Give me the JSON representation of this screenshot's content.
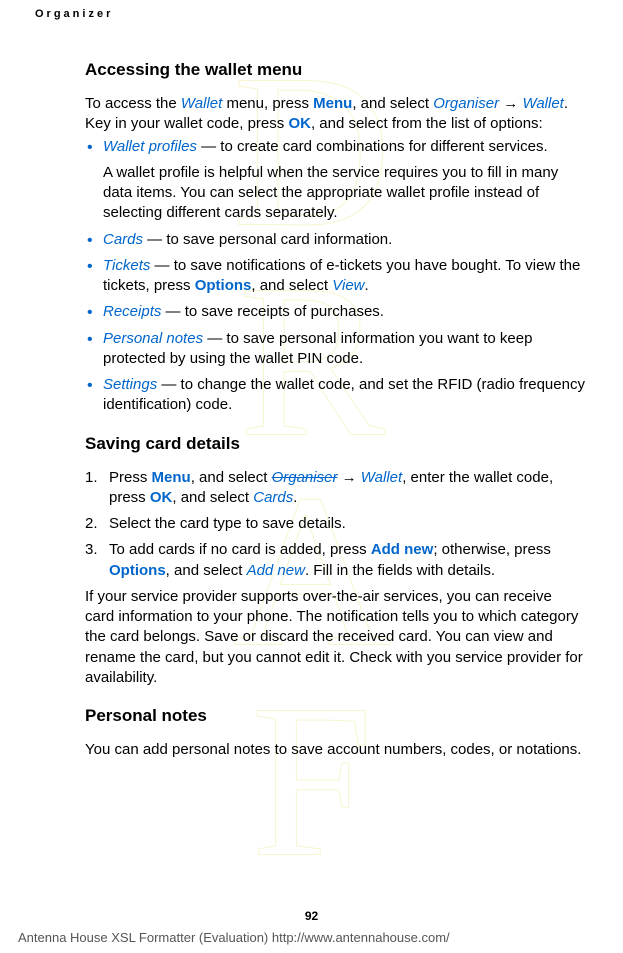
{
  "header": "Organizer",
  "h1": "Accessing the wallet menu",
  "intro_1": "To access the ",
  "i_wallet": "Wallet",
  "intro_2": " menu, press ",
  "b_menu": "Menu",
  "intro_3": ", and select ",
  "i_organiser": "Organiser",
  "arrow": " → ",
  "intro_4": ". Key in your wallet code, press ",
  "b_ok": "OK",
  "intro_5": ", and select from the list of options:",
  "bullets": [
    {
      "term": "Wallet profiles",
      "text": " — to create card combinations for different services.",
      "sub": "A wallet profile is helpful when the service requires you to fill in many data items. You can select the appropriate wallet profile instead of selecting different cards separately."
    },
    {
      "term": "Cards",
      "text": " — to save personal card information."
    },
    {
      "term": "Tickets",
      "text_before": " — to save notifications of e-tickets you have bought. To view the tickets, press ",
      "action": "Options",
      "text_mid": ", and select ",
      "italic2": "View",
      "text_after": "."
    },
    {
      "term": "Receipts",
      "text": " — to save receipts of purchases."
    },
    {
      "term": "Personal notes",
      "text": " — to save personal information you want to keep protected by using the wallet PIN code."
    },
    {
      "term": "Settings",
      "text": " — to change the wallet code, and set the RFID (radio frequency identification) code."
    }
  ],
  "h2": "Saving card details",
  "steps": {
    "s1_a": "Press ",
    "s1_menu": "Menu",
    "s1_b": ", and select ",
    "s1_org": "Organiser",
    "s1_arrow": " → ",
    "s1_wallet": "Wallet",
    "s1_c": ", enter the wallet code, press ",
    "s1_ok": "OK",
    "s1_d": ", and select ",
    "s1_cards": "Cards",
    "s1_e": ".",
    "s2": "Select the card type to save details.",
    "s3_a": "To add cards if no card is added, press ",
    "s3_addnew_b": "Add new",
    "s3_b": "; otherwise, press ",
    "s3_options": "Options",
    "s3_c": ", and select ",
    "s3_addnew_i": "Add new",
    "s3_d": ". Fill in the fields with details."
  },
  "after": "If your service provider supports over-the-air services, you can receive card information to your phone. The notification tells you to which category the card belongs. Save or discard the received card. You can view and rename the card, but you cannot edit it. Check with you service provider for availability.",
  "h3": "Personal notes",
  "notes": "You can add personal notes to save account numbers, codes, or notations.",
  "page": "92",
  "footer": "Antenna House XSL Formatter (Evaluation)  http://www.antennahouse.com/"
}
